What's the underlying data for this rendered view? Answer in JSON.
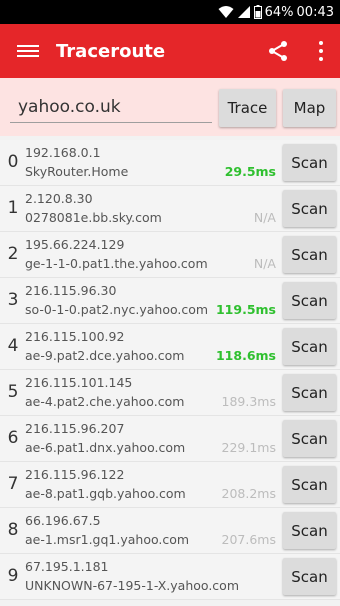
{
  "status": {
    "battery": "64%",
    "time": "00:43"
  },
  "appbar": {
    "title": "Traceroute"
  },
  "search": {
    "value": "yahoo.co.uk",
    "trace_label": "Trace",
    "map_label": "Map"
  },
  "hops": [
    {
      "index": "0",
      "ip": "192.168.0.1",
      "host": "SkyRouter.Home",
      "time": "29.5ms",
      "status": "ok",
      "scan": "Scan"
    },
    {
      "index": "1",
      "ip": "2.120.8.30",
      "host": "0278081e.bb.sky.com",
      "time": "N/A",
      "status": "dim",
      "scan": "Scan"
    },
    {
      "index": "2",
      "ip": "195.66.224.129",
      "host": "ge-1-1-0.pat1.the.yahoo.com",
      "time": "N/A",
      "status": "dim",
      "scan": "Scan"
    },
    {
      "index": "3",
      "ip": "216.115.96.30",
      "host": "so-0-1-0.pat2.nyc.yahoo.com",
      "time": "119.5ms",
      "status": "ok",
      "scan": "Scan"
    },
    {
      "index": "4",
      "ip": "216.115.100.92",
      "host": "ae-9.pat2.dce.yahoo.com",
      "time": "118.6ms",
      "status": "ok",
      "scan": "Scan"
    },
    {
      "index": "5",
      "ip": "216.115.101.145",
      "host": "ae-4.pat2.che.yahoo.com",
      "time": "189.3ms",
      "status": "dim",
      "scan": "Scan"
    },
    {
      "index": "6",
      "ip": "216.115.96.207",
      "host": "ae-6.pat1.dnx.yahoo.com",
      "time": "229.1ms",
      "status": "dim",
      "scan": "Scan"
    },
    {
      "index": "7",
      "ip": "216.115.96.122",
      "host": "ae-8.pat1.gqb.yahoo.com",
      "time": "208.2ms",
      "status": "dim",
      "scan": "Scan"
    },
    {
      "index": "8",
      "ip": "66.196.67.5",
      "host": "ae-1.msr1.gq1.yahoo.com",
      "time": "207.6ms",
      "status": "dim",
      "scan": "Scan"
    },
    {
      "index": "9",
      "ip": "67.195.1.181",
      "host": "UNKNOWN-67-195-1-X.yahoo.com",
      "time": "",
      "status": "dim",
      "scan": "Scan"
    }
  ],
  "colors": {
    "appbar": "#e52629",
    "searchbar": "#fde3e2",
    "ok_time": "#2fc02f",
    "dim_time": "#bcbcbc"
  }
}
